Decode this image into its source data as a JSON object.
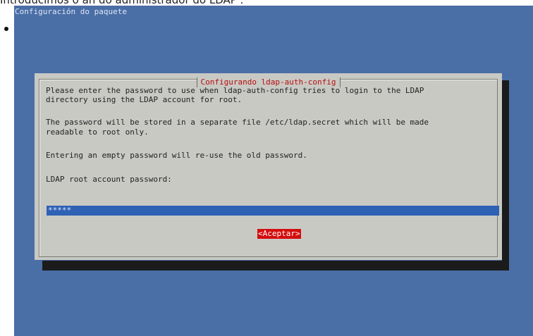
{
  "caption": "Introducimos o an do administrador do LDAP .",
  "screen": {
    "package_title": "Configuración do paquete",
    "dialog": {
      "title": "Configurando ldap-auth-config",
      "line1": "Please enter the password to use when ldap-auth-config tries to login to the LDAP",
      "line2": "directory using the LDAP account for root.",
      "line3": "The password will be stored in a separate file /etc/ldap.secret which will be made",
      "line4": "readable to root only.",
      "line5": "Entering an empty password will re-use the old password.",
      "prompt": "LDAP root account password:",
      "password_value": "*****",
      "ok_button": "<Aceptar>"
    }
  }
}
